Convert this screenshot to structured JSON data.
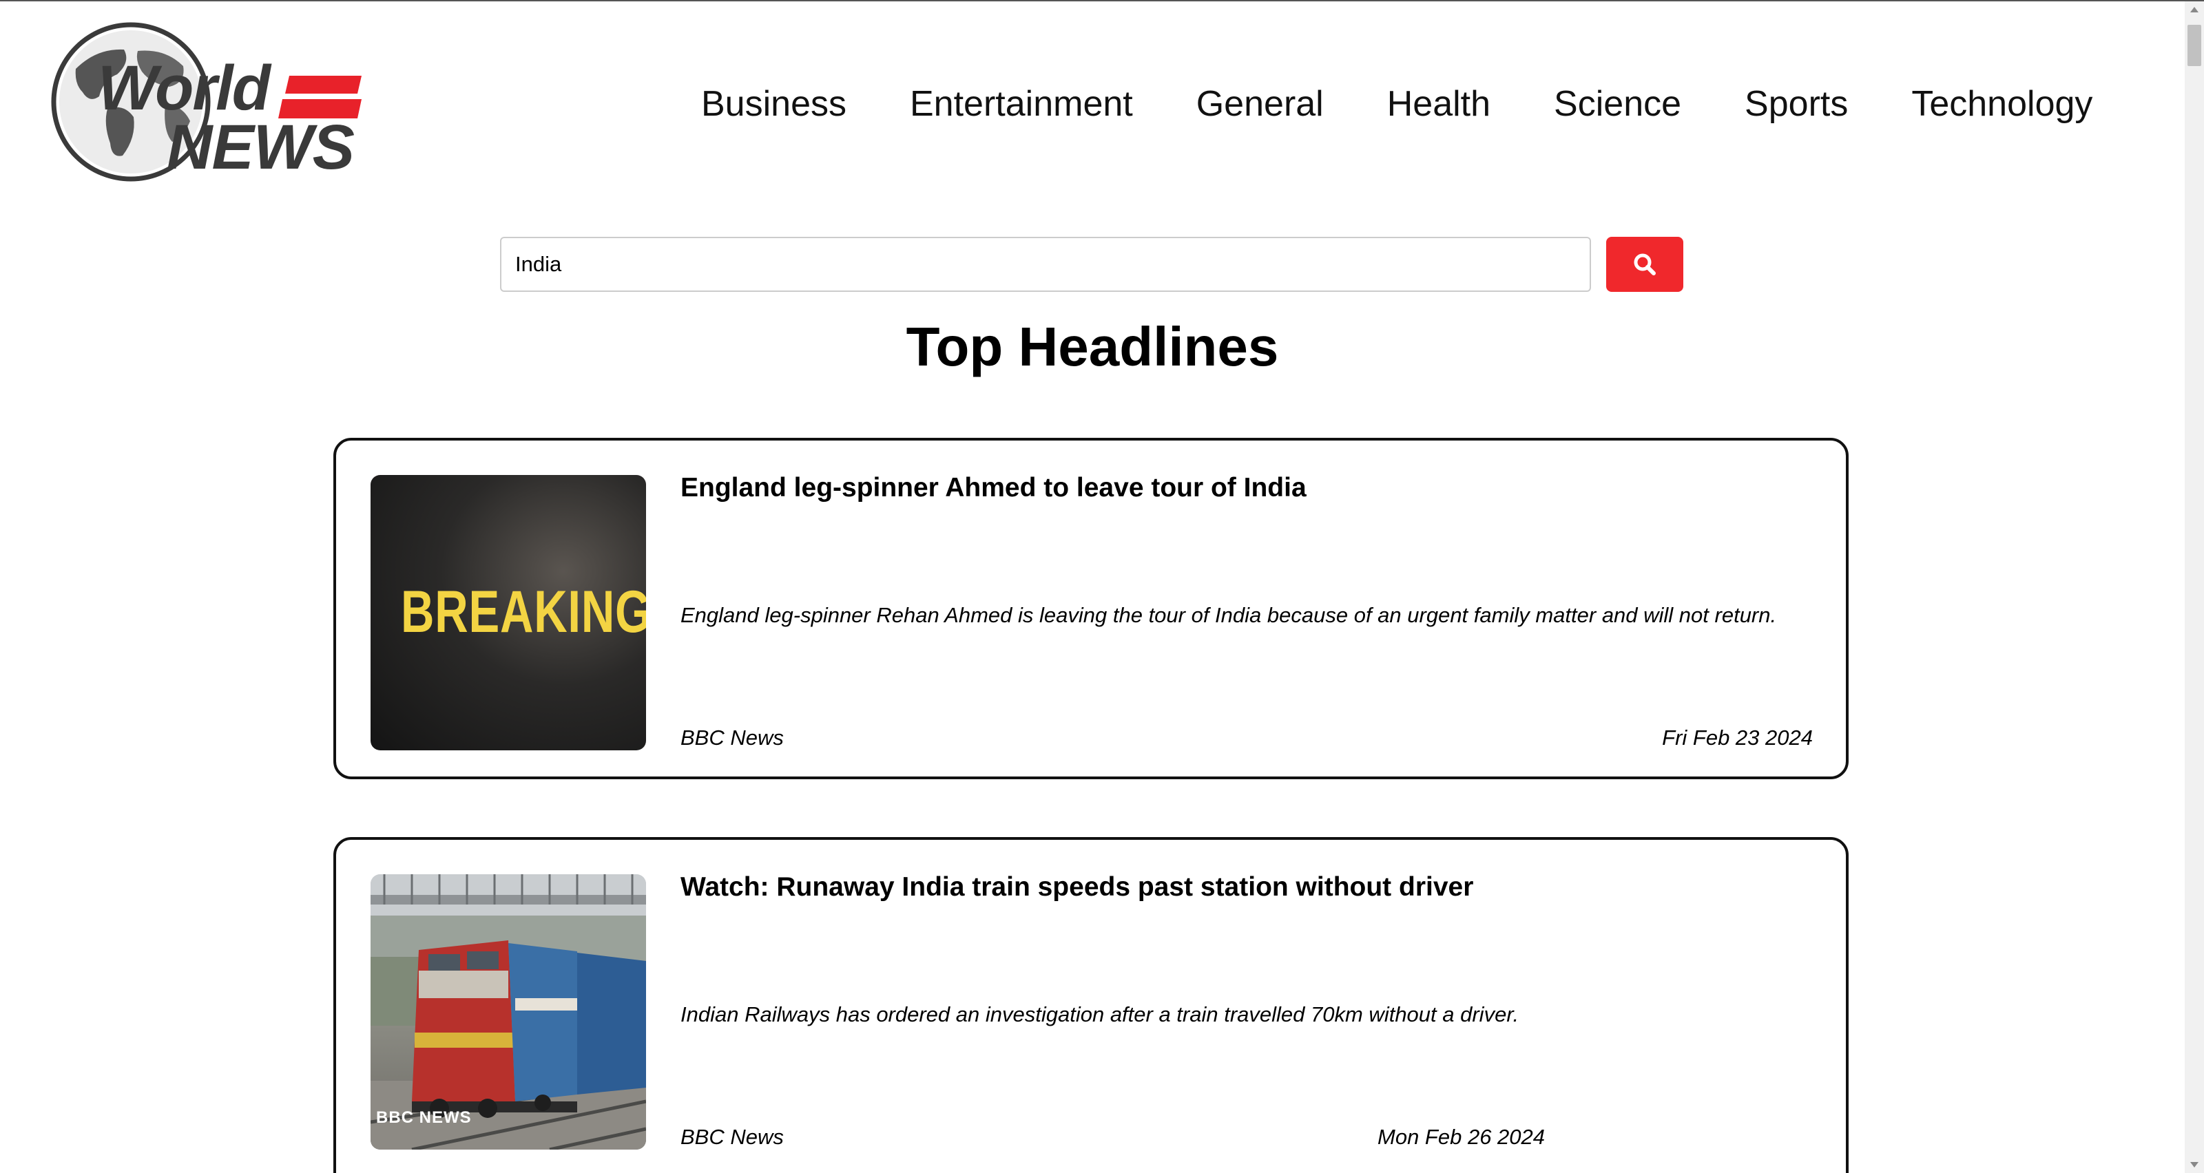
{
  "header": {
    "logo": {
      "line1": "World",
      "line2": "NEWS"
    },
    "nav": [
      {
        "label": "Business"
      },
      {
        "label": "Entertainment"
      },
      {
        "label": "General"
      },
      {
        "label": "Health"
      },
      {
        "label": "Science"
      },
      {
        "label": "Sports"
      },
      {
        "label": "Technology"
      }
    ]
  },
  "search": {
    "value": "India",
    "button_icon": "search-icon"
  },
  "main": {
    "title": "Top Headlines",
    "articles": [
      {
        "headline": "England leg-spinner Ahmed to leave tour of India",
        "description": "England leg-spinner Rehan Ahmed is leaving the tour of India because of an urgent family matter and will not return.",
        "source": "BBC News",
        "date": "Fri Feb 23 2024",
        "thumbnail_text": "BREAKING"
      },
      {
        "headline": "Watch: Runaway India train speeds past station without driver",
        "description": "Indian Railways has ordered an investigation after a train travelled 70km without a driver.",
        "source": "BBC News",
        "date": "Mon Feb 26 2024",
        "thumbnail_text": "BBC NEWS"
      }
    ]
  },
  "colors": {
    "accent": "#f0282c",
    "logo_gray": "#3a3a3a",
    "breaking_yellow": "#f3d443"
  }
}
